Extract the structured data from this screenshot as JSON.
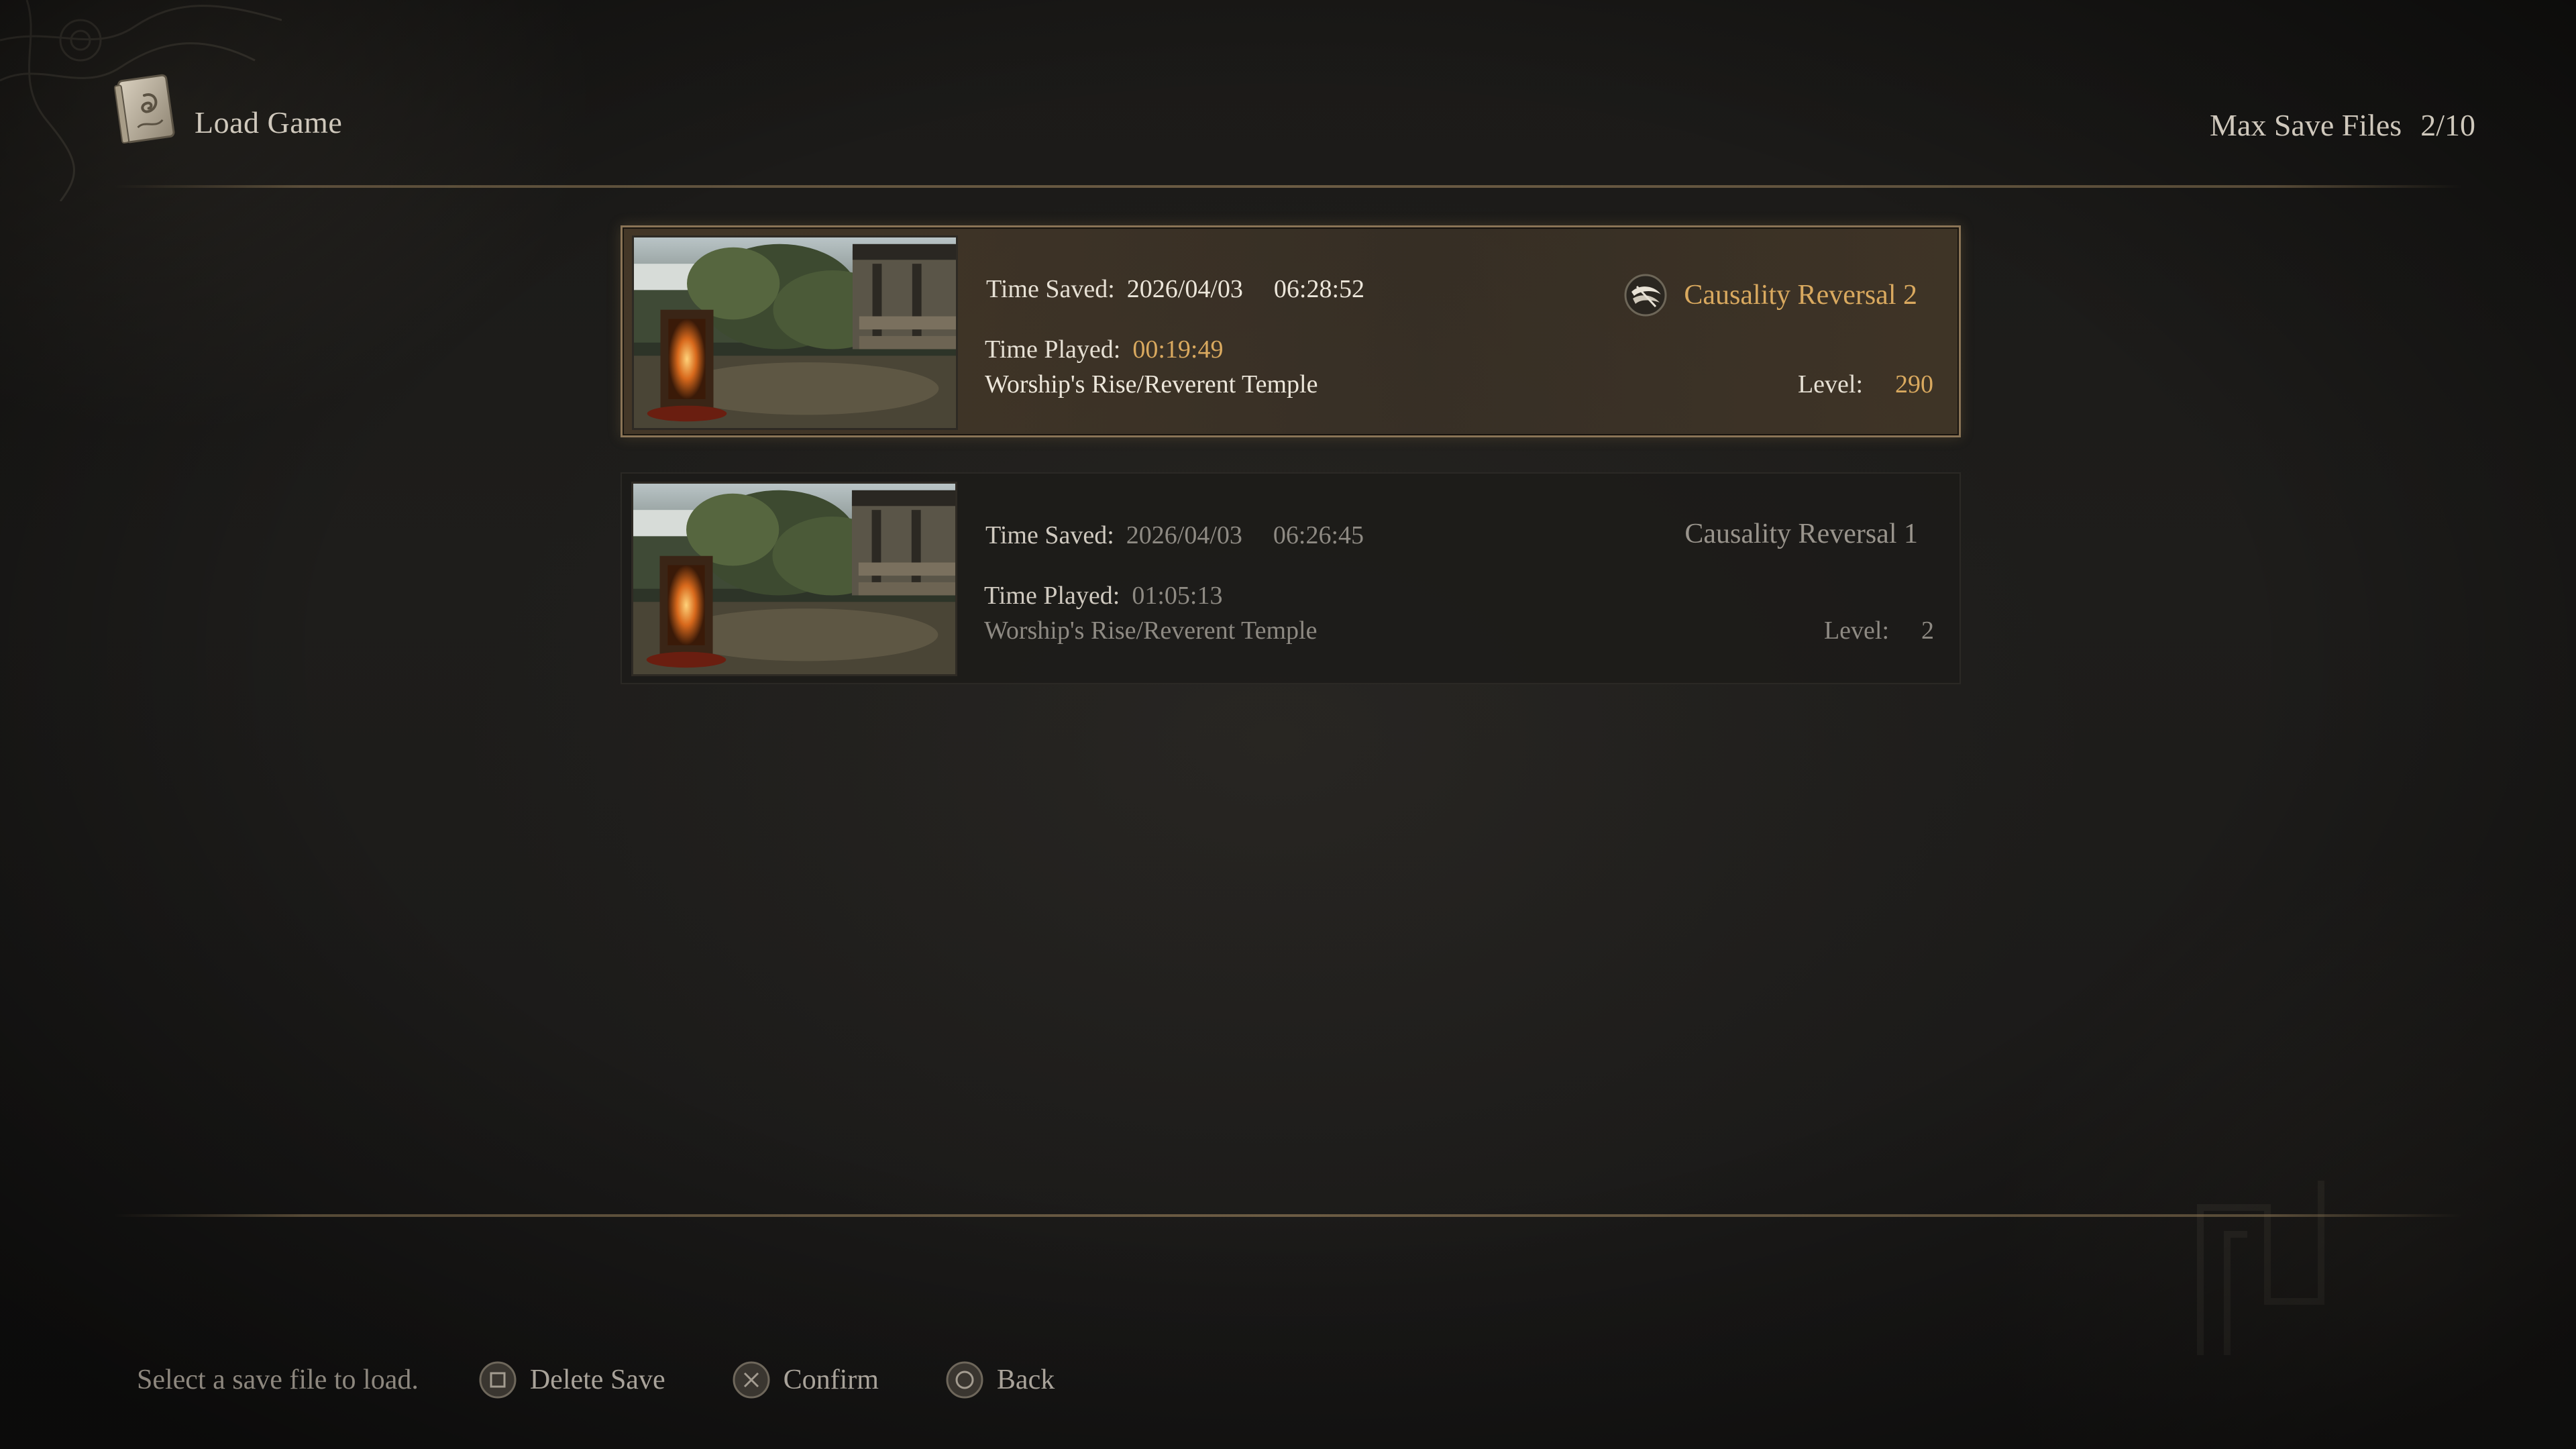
{
  "header": {
    "title": "Load Game",
    "icon": "book-icon",
    "save_count_label": "Max Save Files",
    "save_count_value": "2/10"
  },
  "saves": [
    {
      "selected": true,
      "name": "Causality Reversal 2",
      "name_icon": "seal-icon",
      "time_saved_label": "Time Saved:",
      "date": "2026/04/03",
      "time": "06:28:52",
      "time_played_label": "Time Played:",
      "time_played": "00:19:49",
      "location": "Worship's Rise/Reverent Temple",
      "level_label": "Level:",
      "level": "290"
    },
    {
      "selected": false,
      "name": "Causality Reversal 1",
      "time_saved_label": "Time Saved:",
      "date": "2026/04/03",
      "time": "06:26:45",
      "time_played_label": "Time Played:",
      "time_played": "01:05:13",
      "location": "Worship's Rise/Reverent Temple",
      "level_label": "Level:",
      "level": "2"
    }
  ],
  "footer": {
    "hint": "Select a save file to load.",
    "actions": [
      {
        "icon": "square-button-icon",
        "label": "Delete Save"
      },
      {
        "icon": "cross-button-icon",
        "label": "Confirm"
      },
      {
        "icon": "circle-button-icon",
        "label": "Back"
      }
    ]
  },
  "colors": {
    "accent_gold": "#d9a95f",
    "text_light": "#e6e0d4",
    "text_dim": "#8e8a83",
    "selected_border": "#8a7456"
  }
}
